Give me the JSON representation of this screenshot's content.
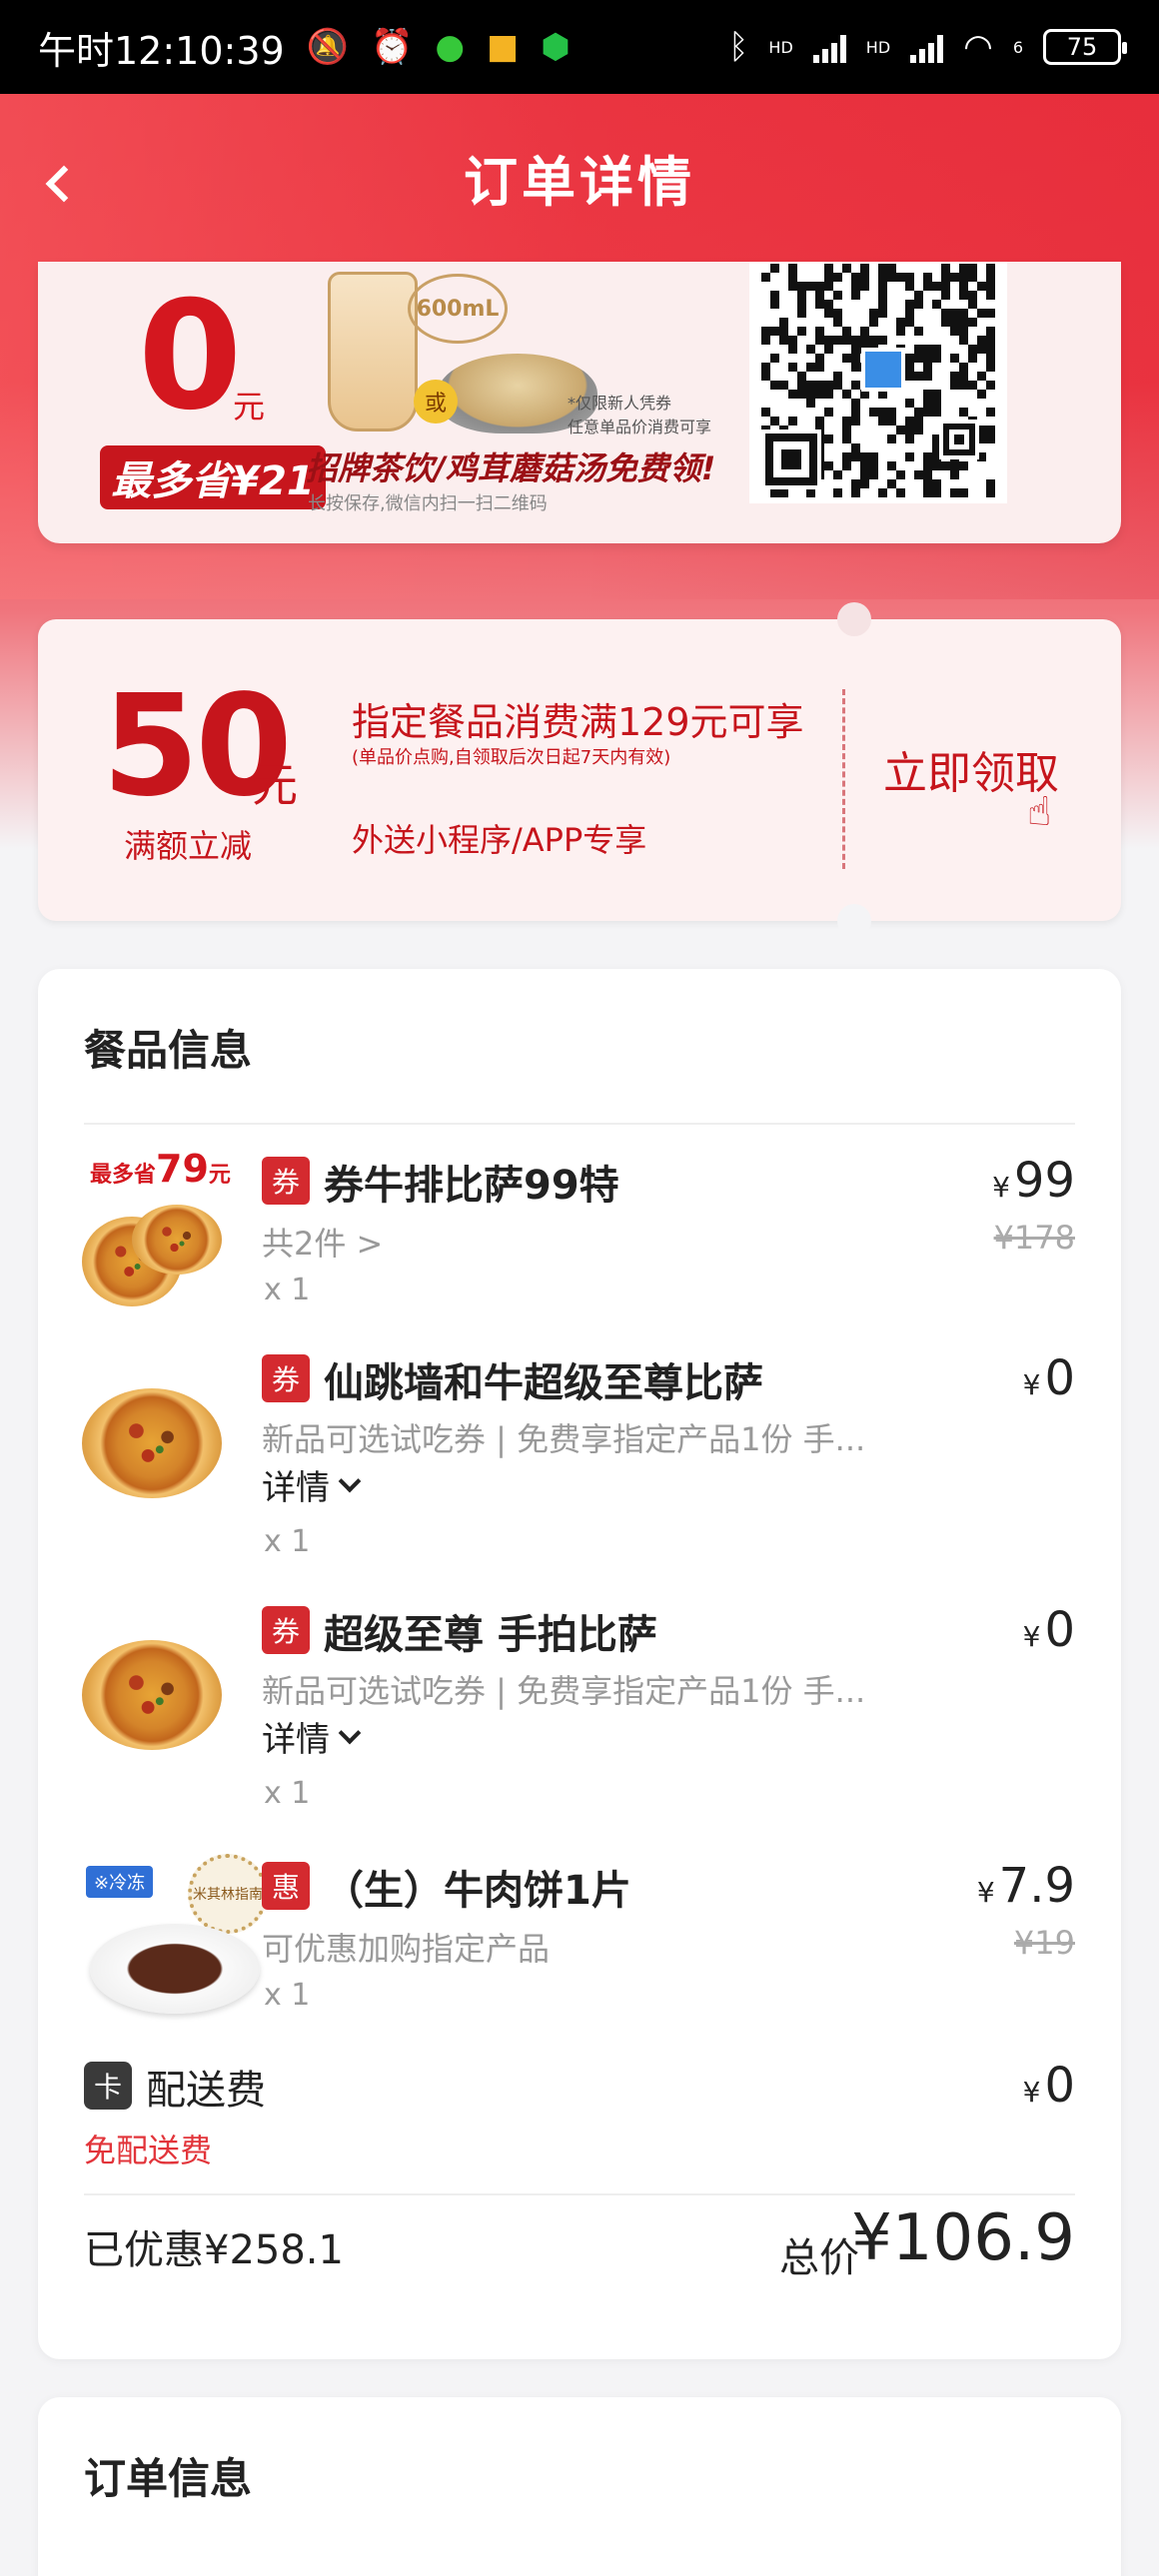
{
  "status_bar": {
    "time": "午时12:10:39",
    "battery": "75",
    "network_hd_1": "HD",
    "network_hd_2": "HD",
    "wifi_sub": "6"
  },
  "header": {
    "title": "订单详情"
  },
  "qr_banner": {
    "amount": "0",
    "amount_unit": "元",
    "save_badge": "最多省¥21",
    "volume": "600mL",
    "or_label": "或",
    "note_line1": "*仅限新人凭券",
    "note_line2": "任意单品价消费可享",
    "promo": "招牌茶饮/鸡茸蘑菇汤免费领!",
    "hint": "长按保存,微信内扫一扫二维码"
  },
  "coupon": {
    "amount": "50",
    "unit": "元",
    "type": "满额立减",
    "condition": "指定餐品消费满129元可享",
    "condition_sub": "(单品价点购,自领取后次日起7天内有效)",
    "channel": "外送小程序/APP专享",
    "cta": "立即领取"
  },
  "food_section": {
    "title": "餐品信息",
    "items": [
      {
        "tag": "券",
        "name": "券牛排比萨99特",
        "sub": "共2件 >",
        "qty": "x 1",
        "currency": "¥",
        "price": "99",
        "original_price": "¥178",
        "badge_prefix": "最多省",
        "badge_amount": "79",
        "badge_unit": "元"
      },
      {
        "tag": "券",
        "name": "仙跳墙和牛超级至尊比萨",
        "sub": "新品可选试吃券 | 免费享指定产品1份 手...",
        "detail": "详情",
        "qty": "x 1",
        "currency": "¥",
        "price": "0"
      },
      {
        "tag": "券",
        "name": "超级至尊 手拍比萨",
        "sub": "新品可选试吃券 | 免费享指定产品1份 手...",
        "detail": "详情",
        "qty": "x 1",
        "currency": "¥",
        "price": "0"
      },
      {
        "tag": "惠",
        "name": "（生）牛肉饼1片",
        "sub": "可优惠加购指定产品",
        "qty": "x 1",
        "currency": "¥",
        "price": "7.9",
        "original_price": "¥19",
        "frozen_label": "※冷冻",
        "michelin_label": "米其林指南"
      }
    ],
    "delivery": {
      "icon_label": "卡",
      "label": "配送费",
      "note": "免配送费",
      "currency": "¥",
      "price": "0"
    },
    "summary": {
      "saved": "已优惠¥258.1",
      "total_label": "总价",
      "total_value": "¥106.9"
    }
  },
  "order_section": {
    "title": "订单信息"
  },
  "colors": {
    "brand_red": "#e9323f",
    "tag_red": "#d42a2f",
    "coupon_red": "#c6151c"
  }
}
